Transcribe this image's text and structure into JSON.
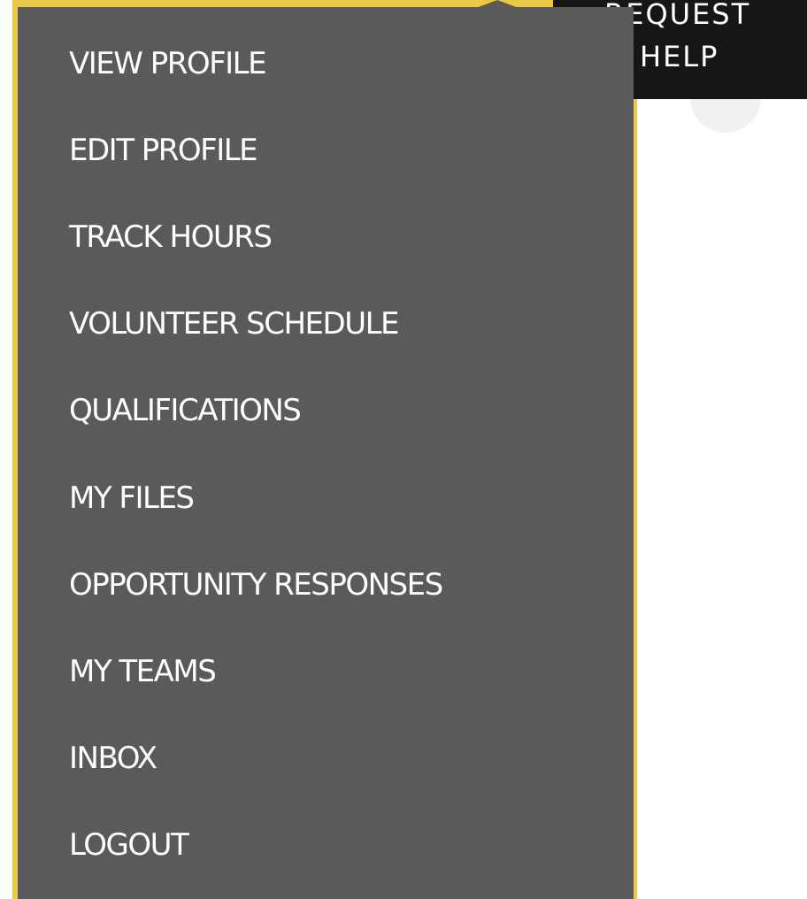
{
  "request_help": {
    "line1": "REQUEST",
    "line2": "HELP"
  },
  "menu": {
    "items": [
      {
        "label": "VIEW PROFILE"
      },
      {
        "label": "EDIT PROFILE"
      },
      {
        "label": "TRACK HOURS"
      },
      {
        "label": "VOLUNTEER SCHEDULE"
      },
      {
        "label": "QUALIFICATIONS"
      },
      {
        "label": "MY FILES"
      },
      {
        "label": "OPPORTUNITY RESPONSES"
      },
      {
        "label": "MY TEAMS"
      },
      {
        "label": "INBOX"
      },
      {
        "label": "LOGOUT"
      }
    ]
  },
  "colors": {
    "menu_background": "#5a5a5a",
    "menu_text": "#ffffff",
    "page_accent": "#e9c84a",
    "button_background": "#161616"
  }
}
